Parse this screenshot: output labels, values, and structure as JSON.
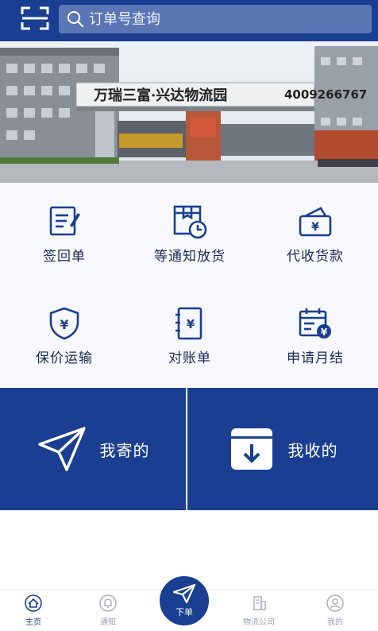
{
  "search": {
    "placeholder": "订单号查询"
  },
  "banner": {
    "gate_sign": "万瑞三富·兴达物流园",
    "phone": "4009266767"
  },
  "services": [
    {
      "label": "签回单",
      "icon": "sign-document-icon"
    },
    {
      "label": "等通知放货",
      "icon": "package-clock-icon"
    },
    {
      "label": "代收货款",
      "icon": "yuan-wallet-icon"
    },
    {
      "label": "保价运输",
      "icon": "yuan-shield-icon"
    },
    {
      "label": "对账单",
      "icon": "yuan-notebook-icon"
    },
    {
      "label": "申请月结",
      "icon": "calendar-yuan-icon"
    }
  ],
  "actions": {
    "sent_label": "我寄的",
    "received_label": "我收的"
  },
  "tabbar": {
    "home": "主页",
    "notice": "通知",
    "order": "下单",
    "company": "物流公司",
    "mine": "我的"
  },
  "colors": {
    "brand": "#1a3f92",
    "accent_search": "#5b76b4"
  }
}
